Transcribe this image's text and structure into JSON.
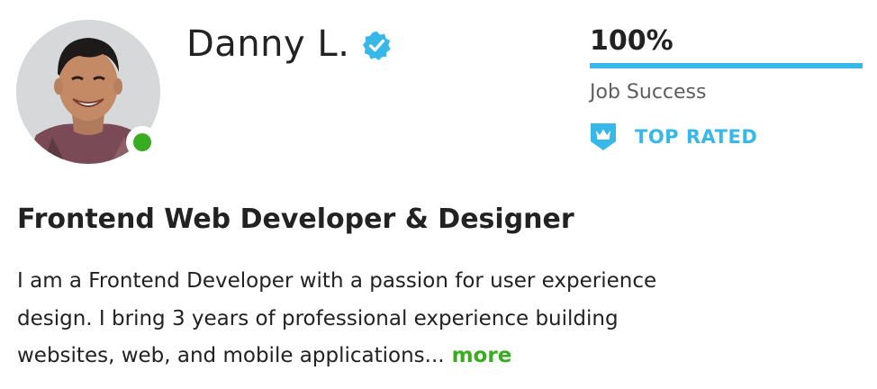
{
  "profile": {
    "name": "Danny L.",
    "title": "Frontend Web Developer & Designer",
    "description_lines": [
      "I am a Frontend Developer with a passion for user experience",
      "design. I bring 3 years of professional experience building",
      "websites, web, and mobile applications..."
    ],
    "more_label": "more",
    "online_status": "online",
    "verified": true
  },
  "stats": {
    "job_success_value": "100%",
    "job_success_percent": 100,
    "job_success_label": "Job Success",
    "badge_label": "TOP RATED"
  },
  "icons": {
    "verified": "verified-badge-icon",
    "top_rated": "top-rated-shield-icon"
  },
  "colors": {
    "accent_blue": "#37b8e8",
    "online_green": "#3aac21",
    "more_link_green": "#3aac21",
    "text_dark": "#222222",
    "text_muted": "#5e5e5e"
  }
}
